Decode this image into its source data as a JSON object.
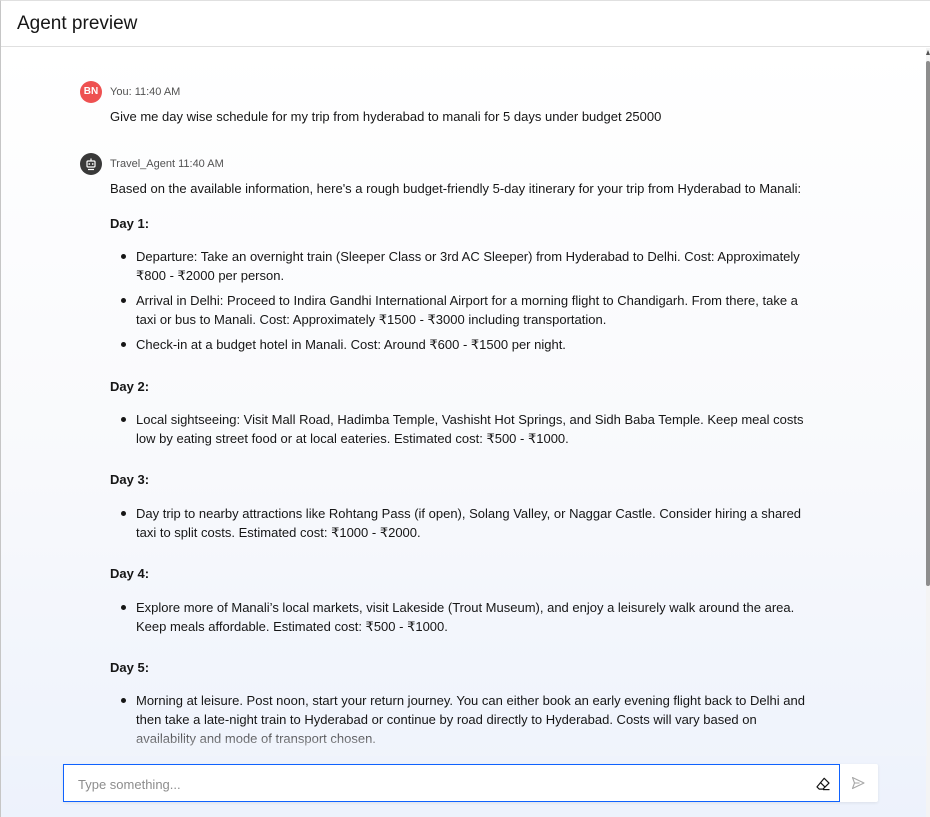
{
  "header": {
    "title": "Agent preview"
  },
  "messages": {
    "user": {
      "avatar_initials": "BN",
      "sender": "You:",
      "time": "11:40 AM",
      "text": "Give me day wise schedule for my trip from hyderabad to manali for 5 days under budget 25000"
    },
    "agent": {
      "sender": "Travel_Agent",
      "time": "11:40 AM",
      "intro": "Based on the available information, here's a rough budget-friendly 5-day itinerary for your trip from Hyderabad to Manali:",
      "days": [
        {
          "heading": "Day 1:",
          "items": [
            "Departure: Take an overnight train (Sleeper Class or 3rd AC Sleeper) from Hyderabad to Delhi. Cost: Approximately ₹800 - ₹2000 per person.",
            "Arrival in Delhi: Proceed to Indira Gandhi International Airport for a morning flight to Chandigarh. From there, take a taxi or bus to Manali. Cost: Approximately ₹1500 - ₹3000 including transportation.",
            "Check-in at a budget hotel in Manali. Cost: Around ₹600 - ₹1500 per night."
          ]
        },
        {
          "heading": "Day 2:",
          "items": [
            "Local sightseeing: Visit Mall Road, Hadimba Temple, Vashisht Hot Springs, and Sidh Baba Temple. Keep meal costs low by eating street food or at local eateries. Estimated cost: ₹500 - ₹1000."
          ]
        },
        {
          "heading": "Day 3:",
          "items": [
            "Day trip to nearby attractions like Rohtang Pass (if open), Solang Valley, or Naggar Castle. Consider hiring a shared taxi to split costs. Estimated cost: ₹1000 - ₹2000."
          ]
        },
        {
          "heading": "Day 4:",
          "items": [
            "Explore more of Manali’s local markets, visit Lakeside (Trout Museum), and enjoy a leisurely walk around the area. Keep meals affordable. Estimated cost: ₹500 - ₹1000."
          ]
        },
        {
          "heading": "Day 5:",
          "items": [
            "Morning at leisure. Post noon, start your return journey. You can either book an early evening flight back to Delhi and then take a late-night train to Hyderabad or continue by road directly to Hyderabad. Costs will vary based on availability and mode of transport chosen."
          ]
        }
      ]
    }
  },
  "composer": {
    "placeholder": "Type something...",
    "value": "",
    "clear_icon": "eraser-icon",
    "send_icon": "send-icon"
  },
  "colors": {
    "accent": "#0f62fe",
    "user_avatar": "#ee5151",
    "agent_avatar": "#393939"
  }
}
